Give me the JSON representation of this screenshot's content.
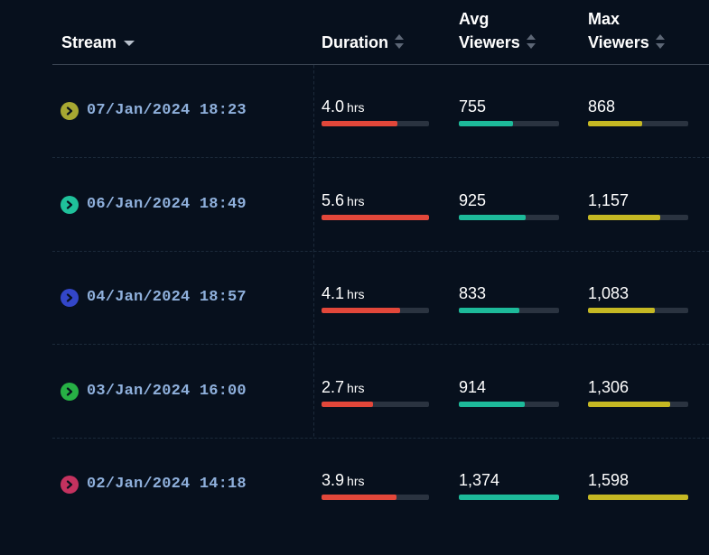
{
  "header": {
    "stream_label": "Stream",
    "duration_label": "Duration",
    "avg_label_line1": "Avg",
    "avg_label_line2": "Viewers",
    "max_label_line1": "Max",
    "max_label_line2": "Viewers"
  },
  "colors": {
    "duration_bar": "#e2473a",
    "avg_bar": "#1dba9a",
    "max_bar": "#c5b823"
  },
  "rows": [
    {
      "date": "07/Jan/2024 18:23",
      "chevron_color": "#a7a832",
      "duration": "4.0",
      "unit": "hrs",
      "duration_fill": 0.71,
      "avg": "755",
      "avg_fill": 0.54,
      "max": "868",
      "max_fill": 0.54
    },
    {
      "date": "06/Jan/2024 18:49",
      "chevron_color": "#1fc19b",
      "duration": "5.6",
      "unit": "hrs",
      "duration_fill": 1.0,
      "avg": "925",
      "avg_fill": 0.67,
      "max": "1,157",
      "max_fill": 0.72
    },
    {
      "date": "04/Jan/2024 18:57",
      "chevron_color": "#3346c8",
      "duration": "4.1",
      "unit": "hrs",
      "duration_fill": 0.73,
      "avg": "833",
      "avg_fill": 0.6,
      "max": "1,083",
      "max_fill": 0.67
    },
    {
      "date": "03/Jan/2024 16:00",
      "chevron_color": "#27b045",
      "duration": "2.7",
      "unit": "hrs",
      "duration_fill": 0.48,
      "avg": "914",
      "avg_fill": 0.66,
      "max": "1,306",
      "max_fill": 0.82
    },
    {
      "date": "02/Jan/2024 14:18",
      "chevron_color": "#c4325f",
      "duration": "3.9",
      "unit": "hrs",
      "duration_fill": 0.7,
      "avg": "1,374",
      "avg_fill": 1.0,
      "max": "1,598",
      "max_fill": 1.0
    }
  ]
}
